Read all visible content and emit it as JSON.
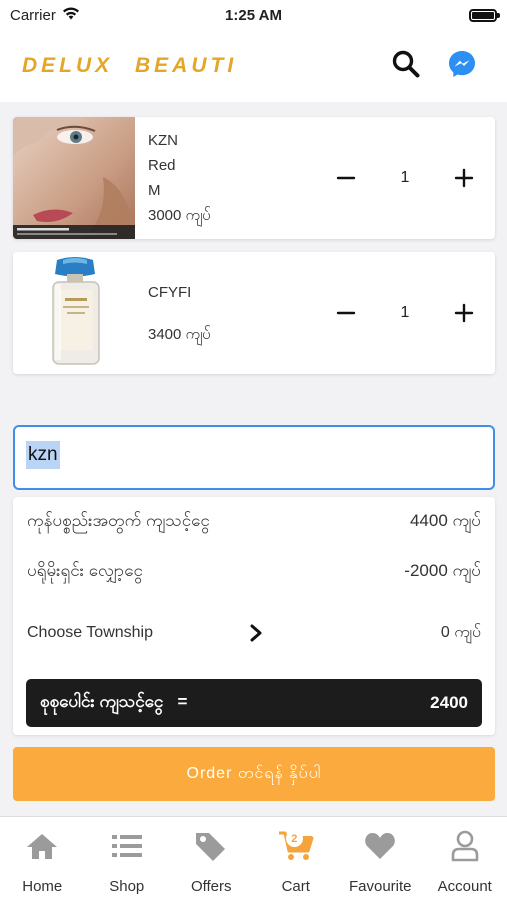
{
  "status_bar": {
    "carrier": "Carrier",
    "time": "1:25 AM"
  },
  "header": {
    "brand": "DELUX  BEAUTI",
    "search_icon": "search-icon",
    "messenger_icon": "messenger-icon"
  },
  "cart": {
    "items": [
      {
        "name": "KZN",
        "color": "Red",
        "size": "M",
        "price": "3000 ကျပ်",
        "quantity": "1",
        "image": "face-model-image"
      },
      {
        "name": "CFYFI",
        "price": "3400 ကျပ်",
        "quantity": "1",
        "image": "perfume-bottle-image"
      }
    ],
    "minus_icon": "minus-icon",
    "plus_icon": "plus-icon"
  },
  "voucher": {
    "value": "kzn"
  },
  "summary": {
    "subtotal_label": "ကုန်ပစ္စည်းအတွက် ကျသင့်ငွေ",
    "subtotal_value": "4400 ကျပ်",
    "discount_label": "ပရိုမိုးရှင်း လျှော့ငွေ",
    "discount_value": "-2000 ကျပ်",
    "township_label": "Choose Township",
    "township_value": "0 ကျပ်",
    "total_label": "စုစုပေါင်း ကျသင့်ငွေ   =",
    "total_value": "2400"
  },
  "order_button": {
    "label": "Order တင်ရန် နှိပ်ပါ"
  },
  "tabs": [
    {
      "label": "Home",
      "icon": "home-icon"
    },
    {
      "label": "Shop",
      "icon": "list-icon"
    },
    {
      "label": "Offers",
      "icon": "tag-icon"
    },
    {
      "label": "Cart",
      "icon": "cart-icon",
      "badge": "2"
    },
    {
      "label": "Favourite",
      "icon": "heart-icon"
    },
    {
      "label": "Account",
      "icon": "user-icon"
    }
  ],
  "colors": {
    "accent": "#fbab3d",
    "brand": "#e3a627",
    "input_border": "#3f8ee8",
    "total_bar": "#1c1c1c",
    "tab_icon": "#9b9b9b"
  }
}
